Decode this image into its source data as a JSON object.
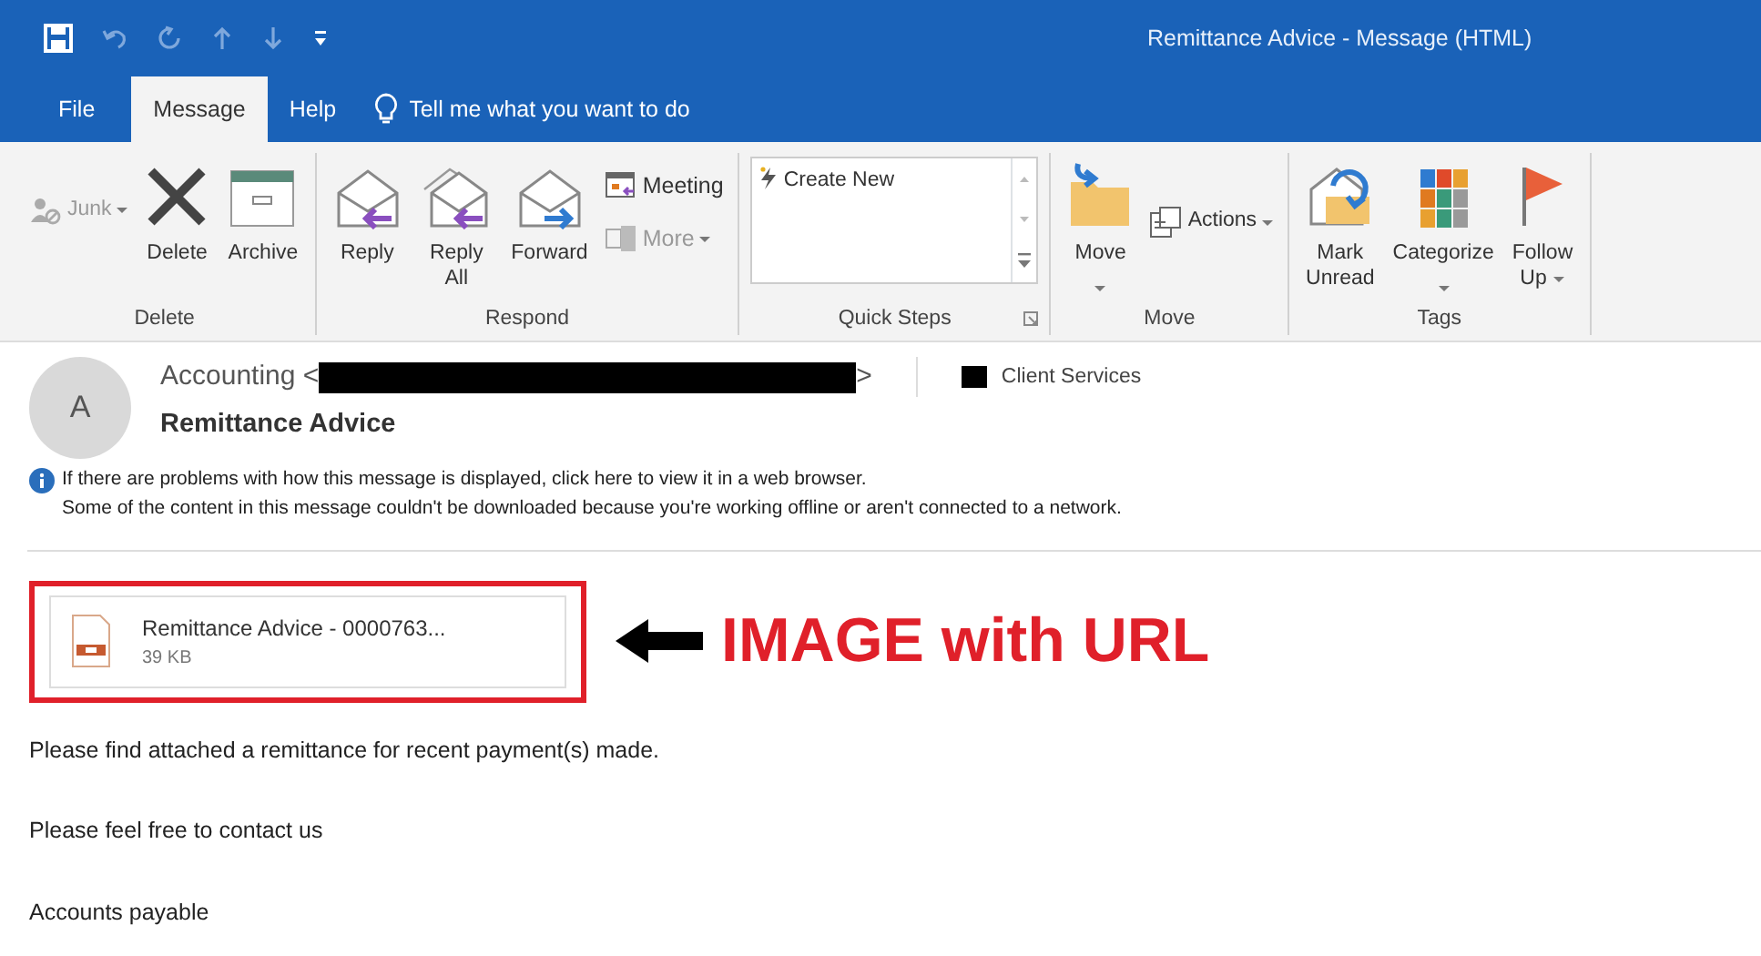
{
  "window": {
    "title": "Remittance Advice  -  Message (HTML)"
  },
  "tabs": [
    {
      "label": "File",
      "selected": false
    },
    {
      "label": "Message",
      "selected": true
    },
    {
      "label": "Help",
      "selected": false
    }
  ],
  "tell_me": {
    "placeholder": "Tell me what you want to do"
  },
  "ribbon": {
    "groups": [
      {
        "label": "Delete",
        "buttons": [
          {
            "label": "Junk",
            "kind": "small",
            "disabled": true,
            "dropdown": true
          },
          {
            "label": "Delete",
            "kind": "large",
            "disabled": false,
            "dropdown": false
          },
          {
            "label": "Archive",
            "kind": "large",
            "disabled": false,
            "dropdown": false
          }
        ]
      },
      {
        "label": "Respond",
        "buttons": [
          {
            "label": "Reply",
            "kind": "large",
            "disabled": false,
            "dropdown": false
          },
          {
            "label": "Reply All",
            "kind": "large",
            "disabled": false,
            "dropdown": false
          },
          {
            "label": "Forward",
            "kind": "large",
            "disabled": false,
            "dropdown": false
          },
          {
            "label": "Meeting",
            "kind": "stack",
            "disabled": false,
            "dropdown": false
          },
          {
            "label": "More",
            "kind": "stack",
            "disabled": true,
            "dropdown": true
          }
        ]
      },
      {
        "label": "Quick Steps",
        "buttons": [
          {
            "label": "Create New",
            "kind": "gallery",
            "disabled": false,
            "dropdown": false
          }
        ]
      },
      {
        "label": "Move",
        "buttons": [
          {
            "label": "Move",
            "kind": "large",
            "disabled": false,
            "dropdown": true
          },
          {
            "label": "Actions",
            "kind": "small",
            "disabled": false,
            "dropdown": true
          }
        ]
      },
      {
        "label": "Tags",
        "buttons": [
          {
            "label": "Mark Unread",
            "kind": "large",
            "disabled": false,
            "dropdown": false
          },
          {
            "label": "Categorize",
            "kind": "large",
            "disabled": false,
            "dropdown": true
          },
          {
            "label": "Follow Up",
            "kind": "large",
            "disabled": false,
            "dropdown": true
          }
        ]
      }
    ]
  },
  "message": {
    "avatar": "A",
    "sender": "Accounting <",
    "sender_end": ">",
    "category": {
      "label": "Client Services",
      "color": "#000000"
    },
    "subject": "Remittance Advice",
    "info": [
      "If there are problems with how this message is displayed, click here to view it in a web browser.",
      "Some of the content in this message couldn't be downloaded because you're working offline or aren't connected to a network."
    ],
    "attachment": {
      "name": "Remittance Advice - 0000763...",
      "size": "39 KB"
    },
    "annotation": "IMAGE with URL",
    "body": [
      "Please find attached a remittance for recent payment(s) made.",
      "Please feel free to contact us",
      "Accounts payable"
    ]
  }
}
